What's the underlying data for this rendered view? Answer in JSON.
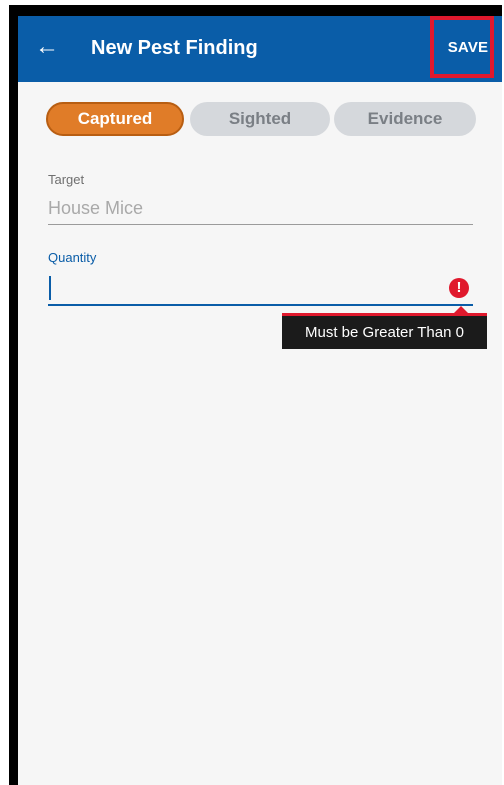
{
  "appbar": {
    "back_icon": "arrow-left-icon",
    "title": "New Pest Finding",
    "save_label": "SAVE",
    "color": "#0a5da8",
    "highlight_color": "#e0192d"
  },
  "tabs": [
    {
      "label": "Captured",
      "active": true
    },
    {
      "label": "Sighted",
      "active": false
    },
    {
      "label": "Evidence",
      "active": false
    }
  ],
  "form": {
    "target": {
      "label": "Target",
      "value": "House Mice"
    },
    "quantity": {
      "label": "Quantity",
      "value": "",
      "error_icon": "exclamation-circle-icon",
      "error_message": "Must be Greater Than 0"
    }
  },
  "colors": {
    "accent": "#e07c28",
    "error": "#e0192d",
    "inactive_tab": "#d5d8dc"
  }
}
